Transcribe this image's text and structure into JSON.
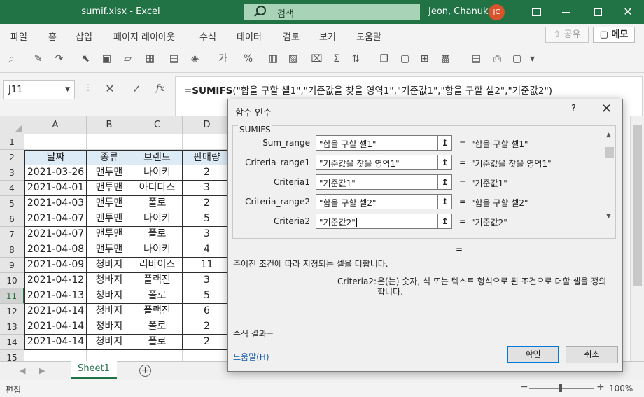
{
  "window": {
    "title": "sumif.xlsx  -  Excel",
    "search_placeholder": "검색",
    "user_name": "Jeon, Chanuk",
    "user_initials": "JC",
    "accent_color": "#217346"
  },
  "menu": {
    "items": [
      "파일",
      "홈",
      "삽입",
      "페이지 레이아웃",
      "수식",
      "데이터",
      "검토",
      "보기",
      "도움말"
    ],
    "share_label": "⇧ 공유",
    "memo_label": "▢ 메모"
  },
  "formula_bar": {
    "name_box": "J11",
    "fx_label": "fx",
    "formula_fn": "=SUMIFS",
    "formula_args": "(\"합을 구할 셀1\",\"기준값을 찾을 영역1\",\"기준값1\",\"합을 구할 셀2\",\"기준값2\")"
  },
  "sheet": {
    "columns": [
      "A",
      "B",
      "C",
      "D"
    ],
    "rows": [
      "1",
      "2",
      "3",
      "4",
      "5",
      "6",
      "7",
      "8",
      "9",
      "10",
      "11",
      "12",
      "13",
      "14",
      "15"
    ],
    "header_row": [
      "날짜",
      "종류",
      "브랜드",
      "판매량"
    ],
    "data": [
      [
        "2021-03-26",
        "맨투맨",
        "나이키",
        "2"
      ],
      [
        "2021-04-01",
        "맨투맨",
        "아디다스",
        "3"
      ],
      [
        "2021-04-03",
        "맨투맨",
        "폴로",
        "2"
      ],
      [
        "2021-04-07",
        "맨투맨",
        "나이키",
        "5"
      ],
      [
        "2021-04-07",
        "맨투맨",
        "폴로",
        "3"
      ],
      [
        "2021-04-08",
        "맨투맨",
        "나이키",
        "4"
      ],
      [
        "2021-04-09",
        "청바지",
        "리바이스",
        "11"
      ],
      [
        "2021-04-12",
        "청바지",
        "플랙진",
        "3"
      ],
      [
        "2021-04-13",
        "청바지",
        "폴로",
        "5"
      ],
      [
        "2021-04-14",
        "청바지",
        "플랙진",
        "6"
      ],
      [
        "2021-04-14",
        "청바지",
        "폴로",
        "2"
      ],
      [
        "2021-04-14",
        "청바지",
        "폴로",
        "2"
      ]
    ],
    "selected_row": "11"
  },
  "tabs": {
    "sheet_name": "Sheet1",
    "add_label": "+"
  },
  "status": {
    "mode": "편집",
    "zoom": "100%"
  },
  "dialog": {
    "title": "함수 인수",
    "help": "?",
    "close": "✕",
    "function_name": "SUMIFS",
    "args": [
      {
        "label": "Sum_range",
        "input": "\"합을 구할 셀1\"",
        "value": "\"합을 구할 셀1\""
      },
      {
        "label": "Criteria_range1",
        "input": "\"기준값을 찾을 영역1\"",
        "value": "\"기준값을 찾을 영역1\""
      },
      {
        "label": "Criteria1",
        "input": "\"기준값1\"",
        "value": "\"기준값1\""
      },
      {
        "label": "Criteria_range2",
        "input": "\"합을 구할 셀2\"",
        "value": "\"합을 구할 셀2\""
      },
      {
        "label": "Criteria2",
        "input": "\"기준값2\"",
        "value": "\"기준값2\""
      }
    ],
    "equals": "=",
    "result_equals": "=",
    "description": "주어진 조건에 따라 지정되는 셀을 더합니다.",
    "arg_name": "Criteria2:",
    "arg_description": "은(는) 숫자, 식 또는 텍스트 형식으로 된 조건으로 더할 셀을 정의합니다.",
    "formula_result": "수식 결과=",
    "help_link": "도움말(H)",
    "ok_label": "확인",
    "cancel_label": "취소"
  }
}
